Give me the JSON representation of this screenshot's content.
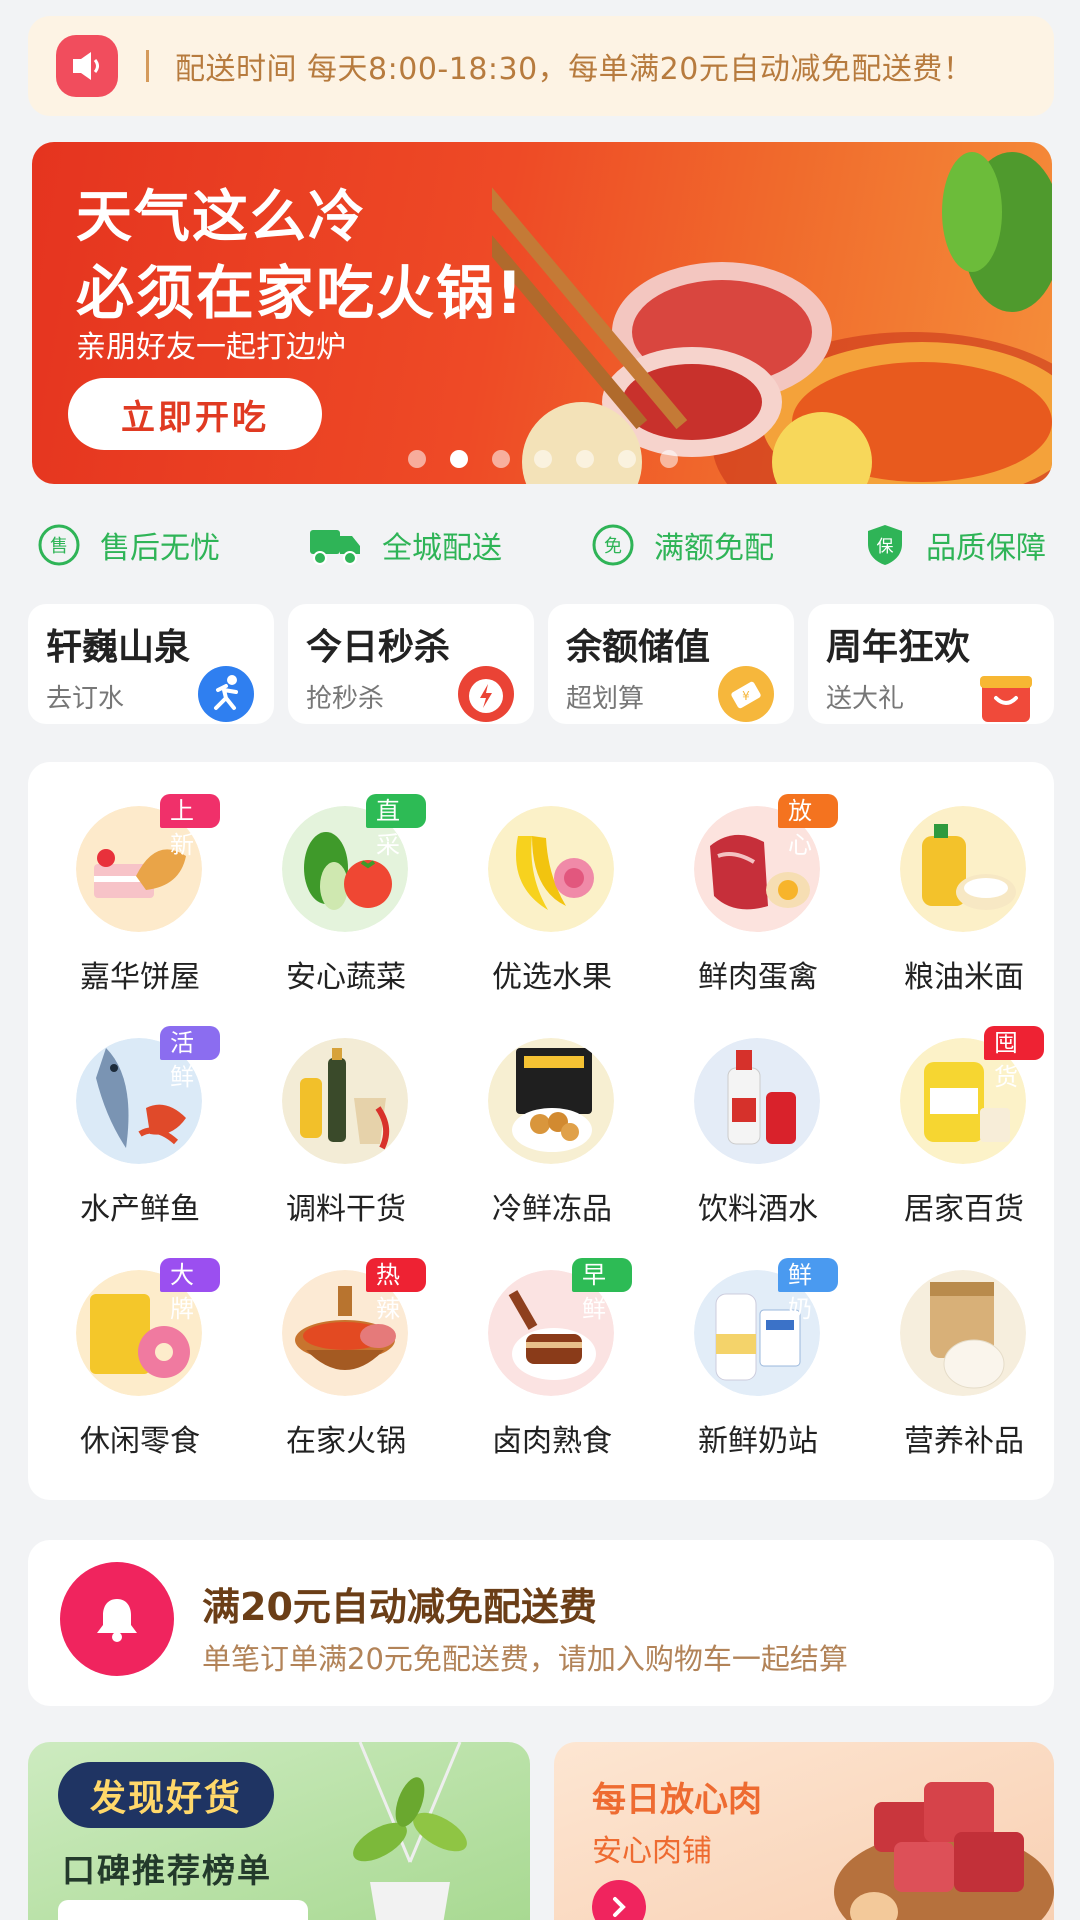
{
  "notice": {
    "icon": "speaker-icon",
    "text": "配送时间 每天8:00-18:30，每单满20元自动减免配送费！"
  },
  "banner": {
    "line1": "天气这么冷",
    "line2": "必须在家吃火锅!",
    "subtitle": "亲朋好友一起打边炉",
    "cta": "立即开吃",
    "active_slide": 2,
    "slide_count": 7
  },
  "services": [
    {
      "label": "售后无忧",
      "icon": "after-sale-icon"
    },
    {
      "label": "全城配送",
      "icon": "truck-icon"
    },
    {
      "label": "满额免配",
      "icon": "free-icon"
    },
    {
      "label": "品质保障",
      "icon": "shield-icon"
    }
  ],
  "quick": [
    {
      "title": "轩巍山泉",
      "sub": "去订水",
      "icon": "runner-icon"
    },
    {
      "title": "今日秒杀",
      "sub": "抢秒杀",
      "icon": "lightning-icon"
    },
    {
      "title": "余额储值",
      "sub": "超划算",
      "icon": "coupon-icon"
    },
    {
      "title": "周年狂欢",
      "sub": "送大礼",
      "icon": "gift-box-icon"
    }
  ],
  "categories": [
    {
      "name": "嘉华饼屋",
      "tag": "上新",
      "tag_color": "#f0306a",
      "icon": "cake-icon"
    },
    {
      "name": "安心蔬菜",
      "tag": "直采",
      "tag_color": "#2dbb55",
      "icon": "vegetable-icon"
    },
    {
      "name": "优选水果",
      "tag": "",
      "tag_color": "",
      "icon": "fruit-icon"
    },
    {
      "name": "鲜肉蛋禽",
      "tag": "放心",
      "tag_color": "#f4731f",
      "icon": "meat-egg-icon"
    },
    {
      "name": "粮油米面",
      "tag": "",
      "tag_color": "",
      "icon": "rice-oil-icon"
    },
    {
      "name": "水产鲜鱼",
      "tag": "活鲜",
      "tag_color": "#8b6df0",
      "icon": "fish-icon"
    },
    {
      "name": "调料干货",
      "tag": "",
      "tag_color": "",
      "icon": "seasoning-icon"
    },
    {
      "name": "冷鲜冻品",
      "tag": "",
      "tag_color": "",
      "icon": "frozen-food-icon"
    },
    {
      "name": "饮料酒水",
      "tag": "",
      "tag_color": "",
      "icon": "drinks-icon"
    },
    {
      "name": "居家百货",
      "tag": "囤货",
      "tag_color": "#ee2233",
      "icon": "household-icon"
    },
    {
      "name": "休闲零食",
      "tag": "大牌",
      "tag_color": "#9b4ff0",
      "icon": "snacks-icon"
    },
    {
      "name": "在家火锅",
      "tag": "热辣",
      "tag_color": "#ee2233",
      "icon": "hotpot-icon"
    },
    {
      "name": "卤肉熟食",
      "tag": "早鲜",
      "tag_color": "#2dbb55",
      "icon": "braised-meat-icon"
    },
    {
      "name": "新鲜奶站",
      "tag": "鲜奶",
      "tag_color": "#4a9af0",
      "icon": "milk-icon"
    },
    {
      "name": "营养补品",
      "tag": "",
      "tag_color": "",
      "icon": "supplement-icon"
    }
  ],
  "free_delivery": {
    "title": "满20元自动减免配送费",
    "subtitle": "单笔订单满20元免配送费，请加入购物车一起结算",
    "icon": "bell-icon"
  },
  "promo_left": {
    "badge": "发现好货",
    "title": "口碑推荐榜单"
  },
  "promo_right": {
    "title": "每日放心肉",
    "subtitle": "安心肉铺",
    "icon": "arrow-right-icon"
  }
}
